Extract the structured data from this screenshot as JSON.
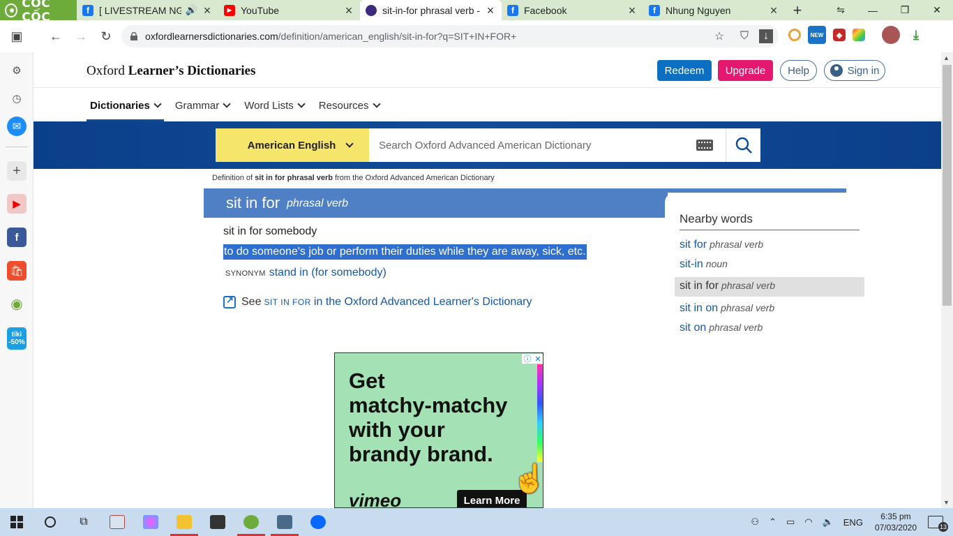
{
  "browser": {
    "brand_label": "CỐC CỐC",
    "tabs": [
      {
        "title": "[ LIVESTREAM NGÀY",
        "favicon": "facebook-icon",
        "color": "#1877f2",
        "active": false,
        "audio": true
      },
      {
        "title": "YouTube",
        "favicon": "youtube-icon",
        "color": "#ff0000",
        "active": false
      },
      {
        "title": "sit-in-for phrasal verb - ",
        "favicon": "oxford-icon",
        "color": "#3c2a7a",
        "active": true
      },
      {
        "title": "Facebook",
        "favicon": "facebook-icon",
        "color": "#1877f2",
        "active": false
      },
      {
        "title": "Nhung Nguyen",
        "favicon": "facebook-icon",
        "color": "#1877f2",
        "active": false
      }
    ],
    "url_main": "oxfordlearnersdictionaries.com",
    "url_path": "/definition/american_english/sit-in-for?q=SIT+IN+FOR+"
  },
  "sidebar": {
    "tiki_line1": "tiki",
    "tiki_line2": "-50%"
  },
  "site": {
    "logo_plain": "Oxford ",
    "logo_bold": "Learner’s Dictionaries",
    "redeem": "Redeem",
    "upgrade": "Upgrade",
    "help": "Help",
    "signin": "Sign in",
    "nav": [
      "Dictionaries",
      "Grammar",
      "Word Lists",
      "Resources"
    ],
    "dictionary_selector": "American English",
    "search_placeholder": "Search Oxford Advanced American Dictionary",
    "accent_blue": "#0b3f8a",
    "accent_yellow": "#f5e56b"
  },
  "entry": {
    "source_prefix": "Definition of ",
    "source_term": "sit in for phrasal verb",
    "source_suffix": " from the Oxford Advanced American Dictionary",
    "headword": "sit in for",
    "pos": "phrasal verb",
    "cf": "sit in for somebody",
    "definition": "to do someone's job or perform their duties while they are away, sick, etc.",
    "synonym_label": "SYNONYM",
    "synonym_value": "stand in (for somebody)",
    "see_prefix": "See",
    "see_term": "SIT IN FOR",
    "see_suffix": "in the Oxford Advanced Learner's Dictionary"
  },
  "nearby": {
    "title": "Nearby words",
    "items": [
      {
        "word": "sit for",
        "pos": "phrasal verb"
      },
      {
        "word": "sit-in",
        "pos": "noun"
      },
      {
        "word": "sit in for",
        "pos": "phrasal verb",
        "current": true
      },
      {
        "word": "sit in on",
        "pos": "phrasal verb"
      },
      {
        "word": "sit on",
        "pos": "phrasal verb"
      }
    ]
  },
  "ad": {
    "line1": "Get",
    "line2": "matchy-matchy",
    "line3": "with your",
    "line4": "brandy brand.",
    "brand": "vimeo",
    "cta": "Learn More"
  },
  "taskbar": {
    "language": "ENG",
    "time": "6:35 pm",
    "date": "07/03/2020",
    "notifications": "13"
  }
}
